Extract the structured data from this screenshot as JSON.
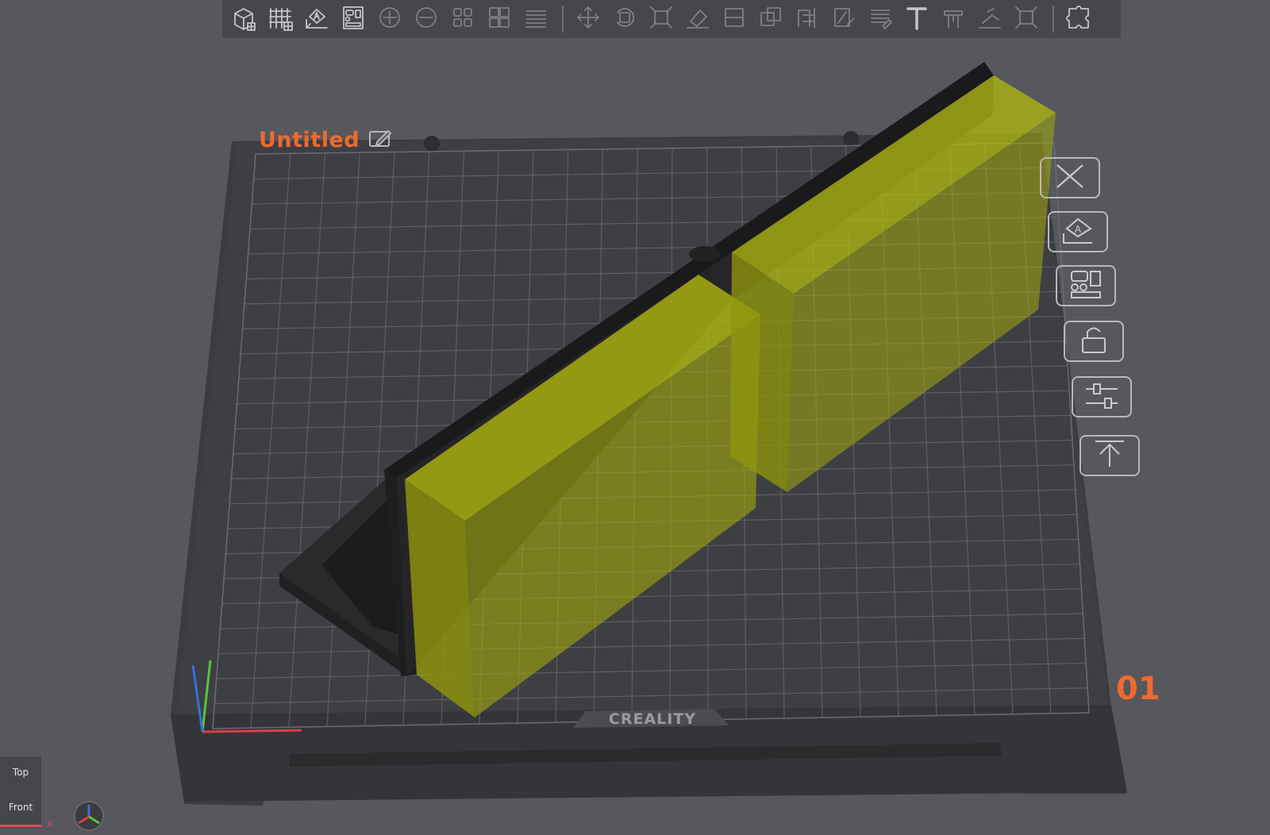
{
  "app": {
    "plate_title": "Untitled",
    "plate_number": "01",
    "bed_brand": "CREALITY"
  },
  "toolbar": {
    "items": [
      {
        "name": "add-object-icon",
        "enabled": true
      },
      {
        "name": "add-plate-icon",
        "enabled": true
      },
      {
        "name": "auto-orient-icon",
        "enabled": true
      },
      {
        "name": "arrange-icon",
        "enabled": true
      },
      {
        "name": "add-instance-icon",
        "enabled": false
      },
      {
        "name": "remove-instance-icon",
        "enabled": false
      },
      {
        "name": "split-objects-icon",
        "enabled": false
      },
      {
        "name": "split-parts-icon",
        "enabled": false
      },
      {
        "name": "layers-icon",
        "enabled": false
      },
      {
        "name": "move-icon",
        "enabled": false
      },
      {
        "name": "rotate-icon",
        "enabled": false
      },
      {
        "name": "scale-icon",
        "enabled": false
      },
      {
        "name": "lay-on-face-icon",
        "enabled": false
      },
      {
        "name": "cut-icon",
        "enabled": false
      },
      {
        "name": "mesh-boolean-icon",
        "enabled": false
      },
      {
        "name": "support-paint-icon",
        "enabled": false
      },
      {
        "name": "seam-paint-icon",
        "enabled": false
      },
      {
        "name": "color-paint-icon",
        "enabled": false
      },
      {
        "name": "text-icon",
        "enabled": true
      },
      {
        "name": "measure-icon",
        "enabled": false
      },
      {
        "name": "assembly-icon",
        "enabled": false
      },
      {
        "name": "fullscreen-icon",
        "enabled": false
      },
      {
        "name": "puzzle-icon",
        "enabled": true
      }
    ]
  },
  "side_buttons": [
    {
      "name": "delete-plate-icon"
    },
    {
      "name": "orient-plate-icon"
    },
    {
      "name": "arrange-plate-icon"
    },
    {
      "name": "lock-plate-icon"
    },
    {
      "name": "plate-settings-icon"
    },
    {
      "name": "move-to-top-icon"
    }
  ],
  "view_buttons": {
    "top": "Top",
    "front": "Front",
    "axis_x": "X"
  },
  "colors": {
    "background": "#56585d",
    "toolbar": "#45474c",
    "accent": "#ee6a2f",
    "bed": "#3a3b3e",
    "model_dark": "#262628",
    "selection_yellow": "#b8bf0a"
  }
}
